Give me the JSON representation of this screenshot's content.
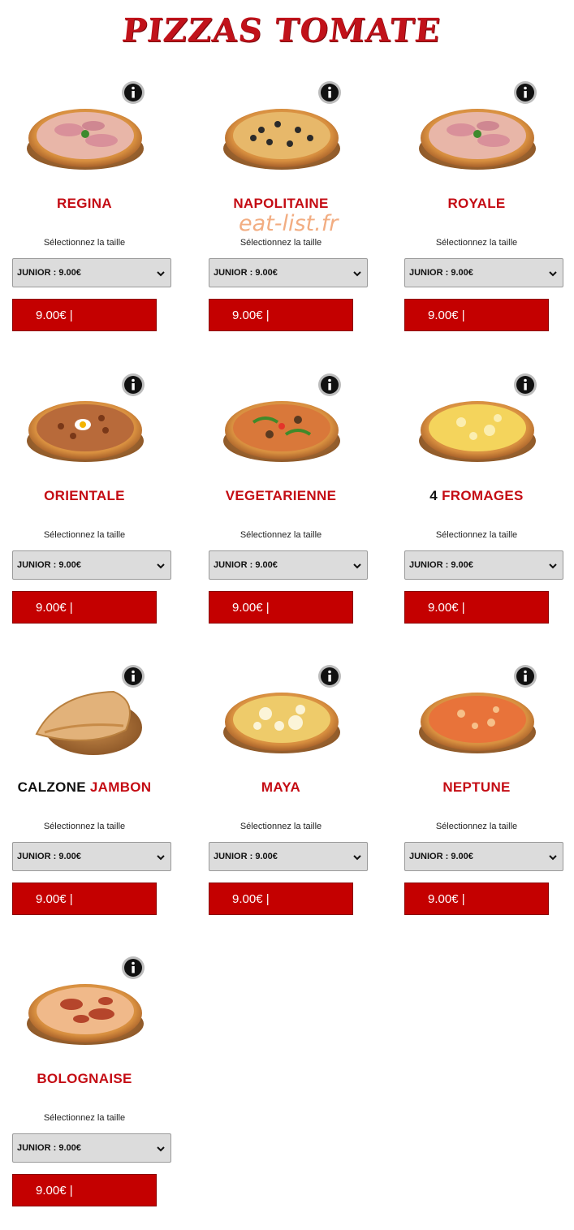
{
  "header": {
    "title": "PIZZAS TOMATE",
    "watermark": "eat-list.fr"
  },
  "colors": {
    "accent": "#c40000",
    "name_red": "#c40c14",
    "select_bg": "#dcdcdc"
  },
  "icons": {
    "info": "info-icon",
    "dropdown": "chevron-down-icon"
  },
  "pizzas": [
    {
      "name": "REGINA",
      "size_label": "Sélectionnez la taille",
      "selected_size": "JUNIOR : 9.00€",
      "price": "9.00€ |"
    },
    {
      "name": "NAPOLITAINE",
      "size_label": "Sélectionnez la taille",
      "selected_size": "JUNIOR : 9.00€",
      "price": "9.00€ |"
    },
    {
      "name": "ROYALE",
      "size_label": "Sélectionnez la taille",
      "selected_size": "JUNIOR : 9.00€",
      "price": "9.00€ |"
    },
    {
      "name": "ORIENTALE",
      "size_label": "Sélectionnez la taille",
      "selected_size": "JUNIOR : 9.00€",
      "price": "9.00€ |"
    },
    {
      "name": "VEGETARIENNE",
      "size_label": "Sélectionnez la taille",
      "selected_size": "JUNIOR : 9.00€",
      "price": "9.00€ |"
    },
    {
      "name_prefix": "4",
      "name": "FROMAGES",
      "size_label": "Sélectionnez la taille",
      "selected_size": "JUNIOR : 9.00€",
      "price": "9.00€ |"
    },
    {
      "name_prefix": "CALZONE",
      "name": "JAMBON",
      "size_label": "Sélectionnez la taille",
      "selected_size": "JUNIOR : 9.00€",
      "price": "9.00€ |"
    },
    {
      "name": "MAYA",
      "size_label": "Sélectionnez la taille",
      "selected_size": "JUNIOR : 9.00€",
      "price": "9.00€ |"
    },
    {
      "name": "NEPTUNE",
      "size_label": "Sélectionnez la taille",
      "selected_size": "JUNIOR : 9.00€",
      "price": "9.00€ |"
    },
    {
      "name": "BOLOGNAISE",
      "size_label": "Sélectionnez la taille",
      "selected_size": "JUNIOR : 9.00€",
      "price": "9.00€ |"
    }
  ]
}
